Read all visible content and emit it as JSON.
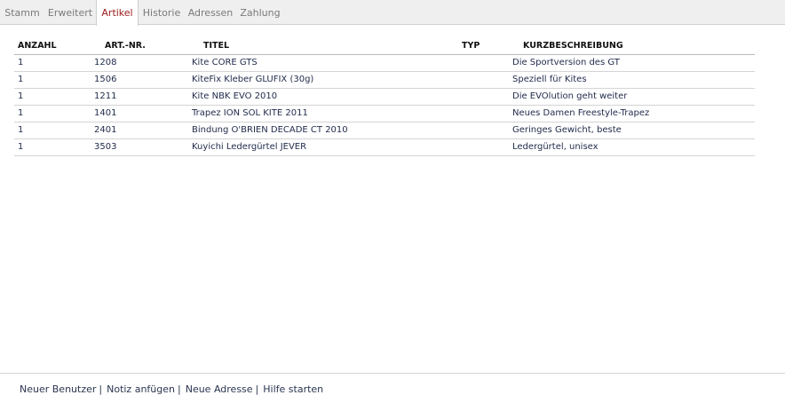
{
  "tabs": [
    {
      "label": "Stamm",
      "active": false
    },
    {
      "label": "Erweitert",
      "active": false
    },
    {
      "label": "Artikel",
      "active": true
    },
    {
      "label": "Historie",
      "active": false
    },
    {
      "label": "Adressen",
      "active": false
    },
    {
      "label": "Zahlung",
      "active": false
    }
  ],
  "table": {
    "headers": {
      "anzahl": "ANZAHL",
      "artnr": "ART.-NR.",
      "titel": "TITEL",
      "typ": "TYP",
      "kurz": "KURZBESCHREIBUNG"
    },
    "rows": [
      {
        "anzahl": "1",
        "artnr": "1208",
        "titel": "Kite CORE GTS",
        "typ": "",
        "kurz": "Die Sportversion des GT"
      },
      {
        "anzahl": "1",
        "artnr": "1506",
        "titel": "KiteFix Kleber GLUFIX (30g)",
        "typ": "",
        "kurz": "Speziell für Kites"
      },
      {
        "anzahl": "1",
        "artnr": "1211",
        "titel": "Kite NBK EVO 2010",
        "typ": "",
        "kurz": "Die EVOlution geht weiter"
      },
      {
        "anzahl": "1",
        "artnr": "1401",
        "titel": "Trapez ION SOL KITE 2011",
        "typ": "",
        "kurz": "Neues Damen Freestyle-Trapez"
      },
      {
        "anzahl": "1",
        "artnr": "2401",
        "titel": "Bindung O'BRIEN DECADE CT 2010",
        "typ": "",
        "kurz": "Geringes Gewicht, beste"
      },
      {
        "anzahl": "1",
        "artnr": "3503",
        "titel": "Kuyichi Ledergürtel JEVER",
        "typ": "",
        "kurz": "Ledergürtel, unisex"
      }
    ]
  },
  "footer": {
    "links": [
      "Neuer Benutzer",
      "Notiz anfügen",
      "Neue Adresse",
      "Hilfe starten"
    ],
    "separator": "|"
  }
}
